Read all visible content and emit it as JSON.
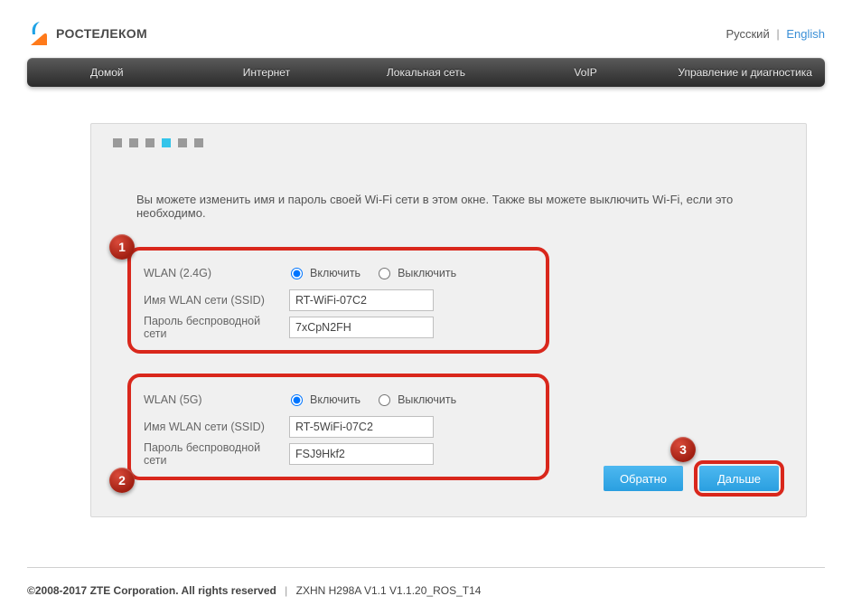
{
  "brand": "РОСТЕЛЕКОМ",
  "lang": {
    "ru": "Русский",
    "en": "English"
  },
  "nav": {
    "home": "Домой",
    "internet": "Интернет",
    "lan": "Локальная сеть",
    "voip": "VoIP",
    "manage": "Управление и диагностика"
  },
  "wizard": {
    "intro": "Вы можете изменить имя и пароль своей Wi-Fi сети в этом окне. Также вы можете выключить Wi-Fi, если это необходимо.",
    "band24": {
      "title": "WLAN (2.4G)",
      "on_label": "Включить",
      "off_label": "Выключить",
      "ssid_label": "Имя WLAN сети (SSID)",
      "ssid_value": "RT-WiFi-07C2",
      "pwd_label": "Пароль беспроводной сети",
      "pwd_value": "7xCpN2FH"
    },
    "band5": {
      "title": "WLAN (5G)",
      "on_label": "Включить",
      "off_label": "Выключить",
      "ssid_label": "Имя WLAN сети (SSID)",
      "ssid_value": "RT-5WiFi-07C2",
      "pwd_label": "Пароль беспроводной сети",
      "pwd_value": "FSJ9Hkf2"
    },
    "back": "Обратно",
    "next": "Дальше",
    "step_active": 4,
    "step_total": 6
  },
  "annotations": {
    "b1": "1",
    "b2": "2",
    "b3": "3"
  },
  "footer": {
    "copyright": "©2008-2017 ZTE Corporation. All rights reserved",
    "model": "ZXHN H298A V1.1 V1.1.20_ROS_T14"
  }
}
